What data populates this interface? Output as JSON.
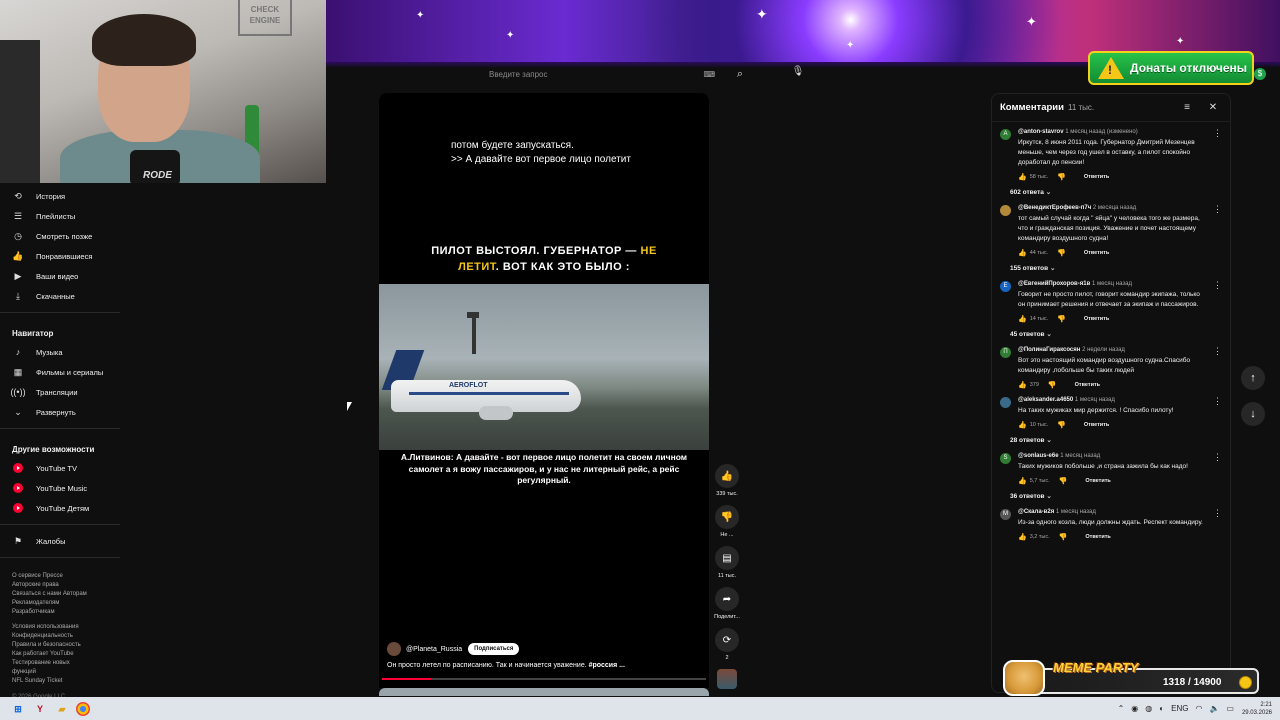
{
  "stream": {
    "webcam_sign": "CHECK ENGINE",
    "mic_brand": "RODE",
    "donations_badge": "Донаты отключены",
    "donations_badge_sub": "$",
    "meme_widget": {
      "title": "MEME PARTY",
      "score": "1318 / 14900"
    }
  },
  "search": {
    "placeholder": "Введите запрос",
    "keyboard_icon": "keyboard-icon"
  },
  "sidebar": {
    "items": [
      {
        "label": "История",
        "icon": "history-icon"
      },
      {
        "label": "Плейлисты",
        "icon": "playlist-icon"
      },
      {
        "label": "Смотреть позже",
        "icon": "clock-icon"
      },
      {
        "label": "Понравившиеся",
        "icon": "thumb-up-icon"
      },
      {
        "label": "Ваши видео",
        "icon": "video-icon"
      },
      {
        "label": "Скачанные",
        "icon": "download-icon"
      }
    ],
    "navigator_heading": "Навигатор",
    "navigator": [
      {
        "label": "Музыка",
        "icon": "music-icon"
      },
      {
        "label": "Фильмы и сериалы",
        "icon": "film-icon"
      },
      {
        "label": "Трансляции",
        "icon": "live-icon"
      },
      {
        "label": "Развернуть",
        "icon": "chevron-down-icon"
      }
    ],
    "more_heading": "Другие возможности",
    "more": [
      {
        "label": "YouTube TV"
      },
      {
        "label": "YouTube Music"
      },
      {
        "label": "YouTube Детям"
      }
    ],
    "report": "Жалобы",
    "footer1": [
      "О сервисе  Прессе",
      "Авторские права",
      "Связаться с нами  Авторам",
      "Рекламодателям",
      "Разработчикам"
    ],
    "footer2": [
      "Условия использования",
      "Конфиденциальность",
      "Правила и безопасность",
      "Как работает YouTube",
      "Тестирование новых",
      "функций",
      "NFL Sunday Ticket"
    ],
    "copyright": "© 2026 Google LLC"
  },
  "video": {
    "caption_line1": "потом будете запускаться.",
    "caption_line2": ">> А давайте вот первое лицо полетит",
    "title_part1": "ПИЛОТ ВЫСТОЯЛ. ГУБЕРНАТОР — ",
    "title_highlight": "НЕ",
    "title_part2": "ЛЕТИТ",
    "title_part3": ". ВОТ КАК ЭТО БЫЛО :",
    "plane_logo": "AEROFLOT",
    "subtitle": "А.Литвинов: А давайте - вот первое лицо полетит на своем личном самолет а я вожу пассажиров, и у нас не литерный рейс, а рейс регулярный.",
    "channel": "@Planeta_Russia",
    "subscribe": "Подписаться",
    "description": "Он просто летел по расписанию. Так и начинается уважение. ",
    "hashtag": "#россия ...",
    "progress": 0.15
  },
  "rail": {
    "likes": "339 тыс.",
    "dislike": "Не ...",
    "comments": "11 тыс.",
    "share": "Поделит...",
    "remix": "2"
  },
  "comments": {
    "title": "Комментарии",
    "count": "11 тыс.",
    "reply_label": "Ответить",
    "items": [
      {
        "author": "@anton-stavrov",
        "time": "1 месяц назад (изменено)",
        "text": "Иркутск, 8 июня 2011 года. Губернатор Дмитрий Мезенцев меньше, чем через год ушел в оставку, а пилот спокойно доработал до пенсии!",
        "likes": "58 тыс.",
        "replies": "602 ответа",
        "avatar_color": "#2e7d32",
        "avatar_letter": "A"
      },
      {
        "author": "@ВенедиктЕрофеев-п7ч",
        "time": "2 месяца назад",
        "text": "тот самый случай когда \" яйца\" у человека того же размера, что и гражданская позиция. Уважение и почет настоящему командиру воздушного судна!",
        "likes": "44 тыс.",
        "replies": "155 ответов",
        "avatar_color": "#b08a3a",
        "avatar_letter": ""
      },
      {
        "author": "@ЕвгенийПрохоров-я1в",
        "time": "1 месяц назад",
        "text": "Говорит не просто пилот, говорит командир экипажа, только он принимает решения и отвечает за экипаж и пассажиров.",
        "likes": "14 тыс.",
        "replies": "45 ответов",
        "avatar_color": "#1565c0",
        "avatar_letter": "Е"
      },
      {
        "author": "@ПолинаГираксосян",
        "time": "2 недели назад",
        "text": "Вот это настоящий командир  воздушного судна.Спасибо командиру ,побольше бы таких людей",
        "likes": "379",
        "replies": "",
        "avatar_color": "#2e7d32",
        "avatar_letter": "П"
      },
      {
        "author": "@aleksander.a4650",
        "time": "1 месяц назад",
        "text": "На таких мужиках мир держится. ! Спасибо пилоту!",
        "likes": "10 тыс.",
        "replies": "28 ответов",
        "avatar_color": "#3a6a8a",
        "avatar_letter": ""
      },
      {
        "author": "@sonlaus-e6e",
        "time": "1 месяц назад",
        "text": "Таких мужиков побольше ,и страна зажила бы как надо!",
        "likes": "5,7 тыс.",
        "replies": "36 ответов",
        "avatar_color": "#2e7d32",
        "avatar_letter": "S"
      },
      {
        "author": "@Скала-в2я",
        "time": "1 месяц назад",
        "text": "Из-за одного козла, люди должны ждать. Респект командиру.",
        "likes": "3,2 тыс.",
        "replies": "",
        "avatar_color": "#555555",
        "avatar_letter": "M"
      }
    ]
  },
  "taskbar": {
    "lang": "ENG",
    "time": "2:21",
    "date": "29.03.2026"
  }
}
